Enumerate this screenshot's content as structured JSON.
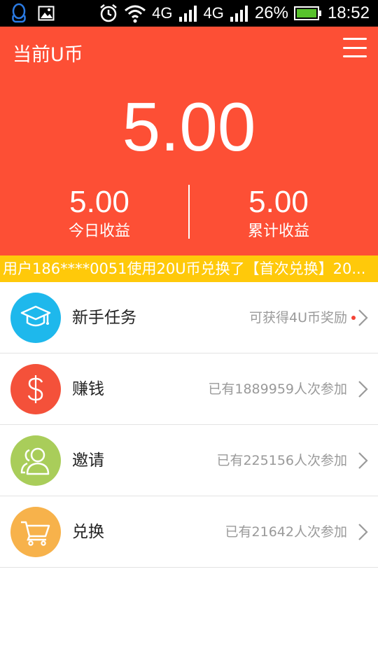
{
  "status_bar": {
    "network_1": "4G",
    "network_2": "4G",
    "battery": "26%",
    "time": "18:52",
    "icons": [
      "qq-icon",
      "image-icon",
      "alarm-icon",
      "wifi-icon",
      "signal-icon",
      "signal-icon",
      "battery-icon"
    ]
  },
  "header": {
    "title": "当前U币",
    "balance": "5.00",
    "today_value": "5.00",
    "today_label": "今日收益",
    "total_value": "5.00",
    "total_label": "累计收益"
  },
  "ticker": {
    "text": "用户186****0051使用20U币兑换了【首次兑换】20..."
  },
  "menu_items": [
    {
      "title": "新手任务",
      "detail": "可获得4U币奖励",
      "icon": "graduation-cap-icon",
      "color": "#1eb8ec",
      "has_dot": true
    },
    {
      "title": "赚钱",
      "detail": "已有1889959人次参加",
      "icon": "dollar-icon",
      "color": "#f4513a"
    },
    {
      "title": "邀请",
      "detail": "已有225156人次参加",
      "icon": "users-icon",
      "color": "#a9cd5a"
    },
    {
      "title": "兑换",
      "detail": "已有21642人次参加",
      "icon": "cart-icon",
      "color": "#f7b24b"
    }
  ],
  "colors": {
    "header_bg": "#fd4f35",
    "ticker_bg": "#ffc90a",
    "status_bg": "#000000"
  }
}
